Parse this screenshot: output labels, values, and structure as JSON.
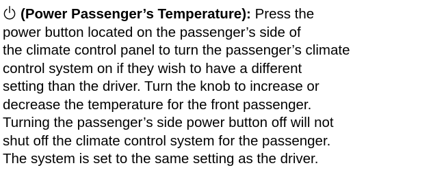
{
  "section": {
    "icon": "power-icon",
    "heading": "(Power Passenger’s Temperature):",
    "lines": [
      "Press the",
      "power button located on the passenger’s side of",
      "the climate control panel to turn the passenger’s climate",
      "control system on if they wish to have a different",
      "setting than the driver. Turn the knob to increase or",
      "decrease the temperature for the front passenger.",
      "Turning the passenger’s side power button off will not",
      "shut off the climate control system for the passenger.",
      "The system is set to the same setting as the driver."
    ]
  }
}
